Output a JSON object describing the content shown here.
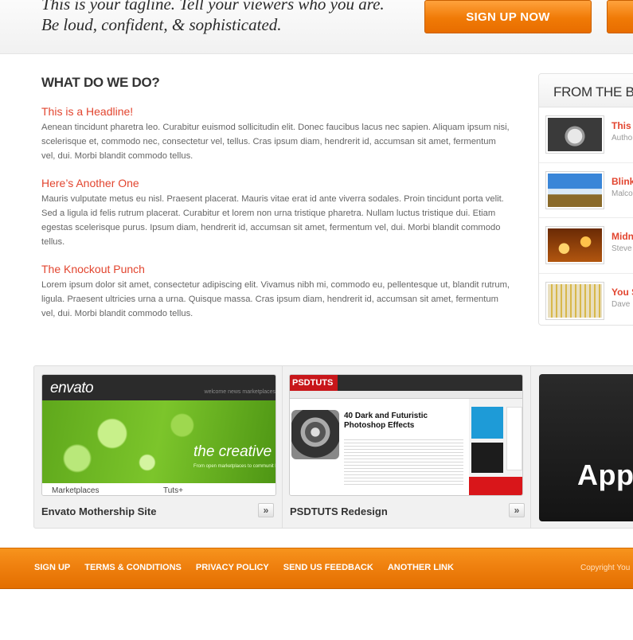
{
  "header": {
    "tagline_line1": "This is your tagline. Tell your viewers who you are.",
    "tagline_line2": "Be loud, confident, & sophisticated.",
    "signup_button": "SIGN UP NOW"
  },
  "main": {
    "section_title": "WHAT DO WE DO?",
    "articles": [
      {
        "headline": "This is a Headline!",
        "body": "Aenean tincidunt pharetra leo. Curabitur euismod sollicitudin elit. Donec faucibus lacus nec sapien. Aliquam ipsum nisi, scelerisque et, commodo nec, consectetur vel, tellus. Cras ipsum diam, hendrerit id, accumsan sit amet, fermentum vel, dui. Morbi blandit commodo tellus."
      },
      {
        "headline": "Here’s Another One",
        "body": "Mauris vulputate metus eu nisl. Praesent placerat. Mauris vitae erat id ante viverra sodales. Proin tincidunt porta velit. Sed a ligula id felis rutrum placerat. Curabitur et lorem non urna tristique pharetra. Nullam luctus tristique dui. Etiam egestas scelerisque purus. Ipsum diam, hendrerit id, accumsan sit amet, fermentum vel, dui. Morbi blandit commodo tellus."
      },
      {
        "headline": "The Knockout Punch",
        "body": "Lorem ipsum dolor sit amet, consectetur adipiscing elit. Vivamus nibh mi, commodo eu, pellentesque ut, blandit rutrum, ligula. Praesent ultricies urna a urna. Quisque massa. Cras ipsum diam, hendrerit id, accumsan sit amet, fermentum vel, dui. Morbi blandit commodo tellus."
      }
    ]
  },
  "blog": {
    "title": "FROM THE B",
    "items": [
      {
        "title": "This",
        "author": "Autho"
      },
      {
        "title": "Blink",
        "author": "Malco"
      },
      {
        "title": "Midn",
        "author": "Steve"
      },
      {
        "title": "You S",
        "author": "Dave"
      }
    ]
  },
  "portfolio": {
    "items": [
      {
        "caption": "Envato Mothership Site",
        "shot_logo": "envato",
        "shot_nav": "welcome    news    marketplaces",
        "shot_tagline": "the creative",
        "shot_small": "From open marketplaces to communit building sites and services that benefit",
        "shot_bottom_left": "Marketplaces",
        "shot_bottom_right": "Tuts+"
      },
      {
        "caption": "PSDTUTS Redesign",
        "shot_logo": "PSDTUTS",
        "shot_headline": "40 Dark and Futuristic Photoshop Effects"
      },
      {
        "caption": "",
        "shot_text": "App"
      }
    ],
    "arrow": "»"
  },
  "footer": {
    "links": [
      "SIGN UP",
      "TERMS & CONDITIONS",
      "PRIVACY POLICY",
      "SEND US FEEDBACK",
      "ANOTHER LINK"
    ],
    "copyright": "Copyright You"
  }
}
